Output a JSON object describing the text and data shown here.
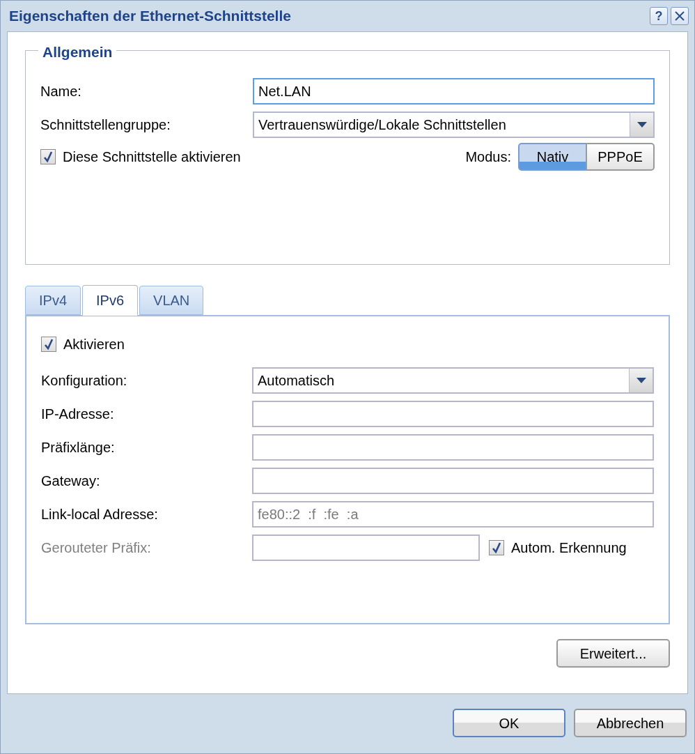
{
  "window": {
    "title": "Eigenschaften der Ethernet-Schnittstelle",
    "help": "?"
  },
  "general": {
    "legend": "Allgemein",
    "fields": [
      {
        "kind": "input",
        "label": "Name:",
        "value": "Net.LAN",
        "focused": true
      },
      {
        "kind": "select",
        "label": "Schnittstellengruppe:",
        "value": "Vertrauenswürdige/Lokale Schnittstellen"
      }
    ],
    "enable": {
      "label": "Diese Schnittstelle aktivieren",
      "checked": true
    },
    "mode": {
      "label": "Modus:",
      "options": [
        {
          "label": "Nativ",
          "selected": true
        },
        {
          "label": "PPPoE",
          "selected": false
        }
      ]
    }
  },
  "tabs": [
    {
      "label": "IPv4",
      "selected": false
    },
    {
      "label": "IPv6",
      "selected": true
    },
    {
      "label": "VLAN",
      "selected": false
    }
  ],
  "ipv6": {
    "activate": {
      "label": "Aktivieren",
      "checked": true
    },
    "fields": [
      {
        "kind": "select",
        "label": "Konfiguration:",
        "value": "Automatisch",
        "disabled": false
      },
      {
        "kind": "input",
        "label": "IP-Adresse:",
        "disabled": false
      },
      {
        "kind": "input",
        "label": "Präfixlänge:",
        "disabled": false
      },
      {
        "kind": "input",
        "label": "Gateway:",
        "disabled": false
      },
      {
        "kind": "readonly",
        "label": "Link-local Adresse:",
        "value": "fe80::2  :f  :fe  :a",
        "disabled": false
      },
      {
        "kind": "input_check",
        "label": "Gerouteter Präfix:",
        "disabled": true,
        "check": {
          "label": "Autom. Erkennung",
          "checked": true
        }
      }
    ]
  },
  "buttons": {
    "advanced": "Erweitert...",
    "footer": [
      {
        "label": "OK",
        "default": true
      },
      {
        "label": "Abbrechen",
        "default": false
      }
    ]
  }
}
